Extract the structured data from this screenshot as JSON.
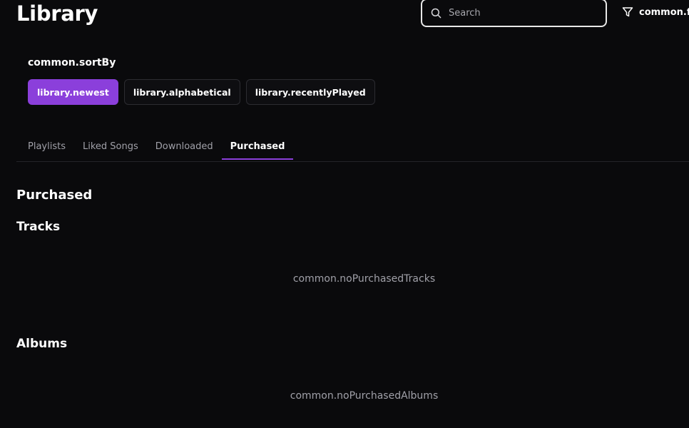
{
  "header": {
    "title": "Library",
    "search": {
      "placeholder": "Search",
      "value": ""
    },
    "filter_label": "common.filters"
  },
  "sort": {
    "label": "common.sortBy",
    "options": [
      {
        "label": "library.newest",
        "active": true
      },
      {
        "label": "library.alphabetical",
        "active": false
      },
      {
        "label": "library.recentlyPlayed",
        "active": false
      }
    ]
  },
  "tabs": [
    {
      "label": "Playlists",
      "active": false
    },
    {
      "label": "Liked Songs",
      "active": false
    },
    {
      "label": "Downloaded",
      "active": false
    },
    {
      "label": "Purchased",
      "active": true
    }
  ],
  "content": {
    "section_title": "Purchased",
    "tracks": {
      "title": "Tracks",
      "empty": "common.noPurchasedTracks"
    },
    "albums": {
      "title": "Albums",
      "empty": "common.noPurchasedAlbums"
    }
  },
  "colors": {
    "accent": "#8b3fdb",
    "background": "#0a0a0c",
    "muted_text": "#a0a0a8"
  }
}
